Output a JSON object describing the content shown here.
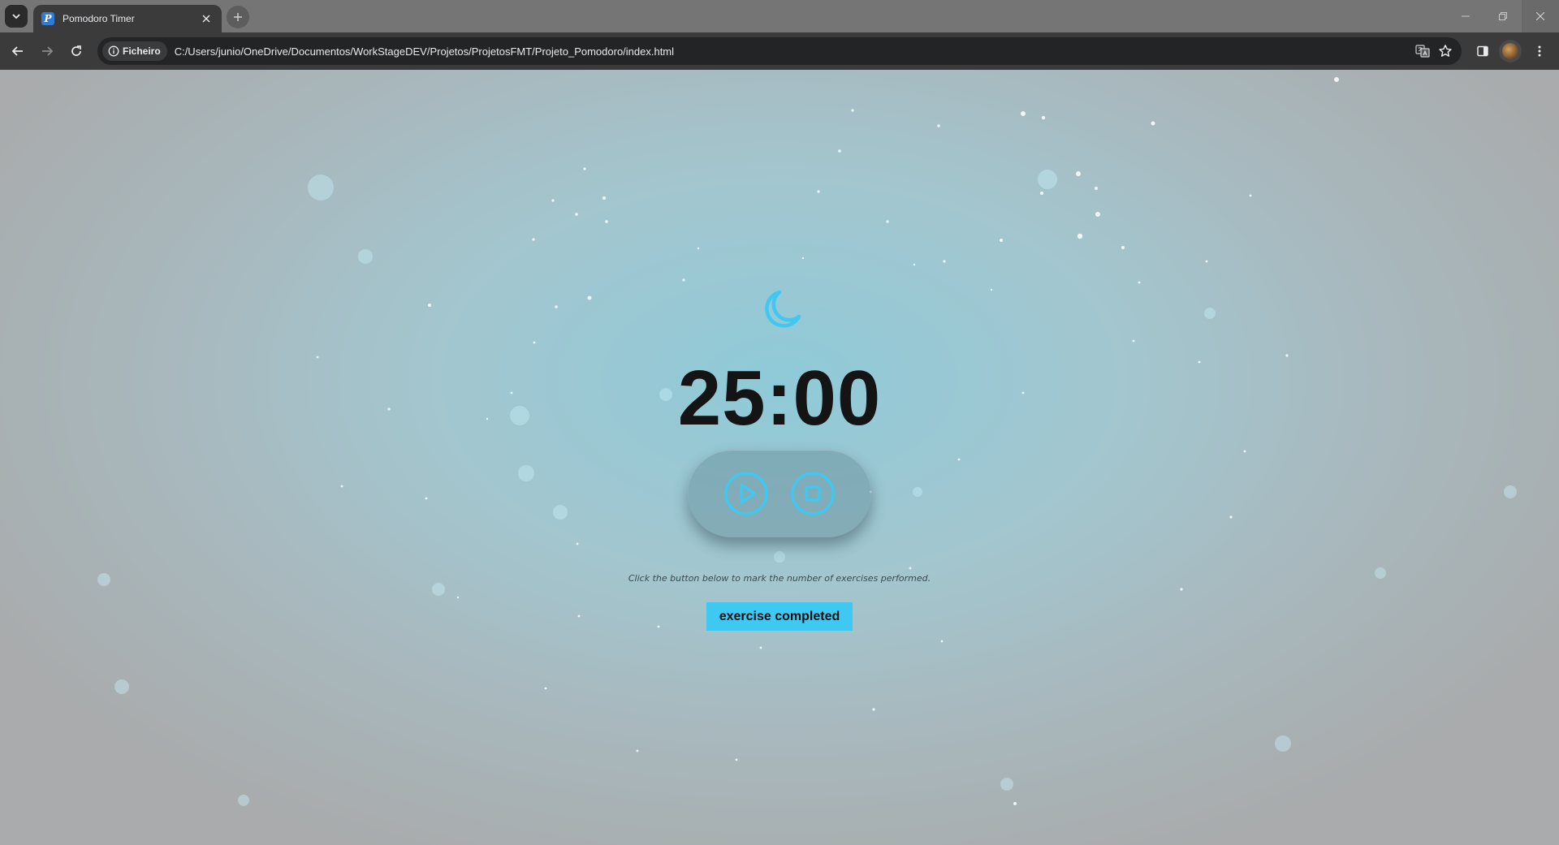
{
  "browser": {
    "tab_title": "Pomodoro Timer",
    "favicon_letter": "P",
    "security_chip": "Ficheiro",
    "url": "C:/Users/junio/OneDrive/Documentos/WorkStageDEV/Projetos/ProjetosFMT/Projeto_Pomodoro/index.html",
    "icons": [
      "tab-search-icon",
      "close-icon",
      "plus-icon",
      "minimize-icon",
      "restore-icon",
      "close-window-icon",
      "back-icon",
      "forward-icon",
      "reload-icon",
      "info-icon",
      "translate-icon",
      "star-icon",
      "side-panel-icon",
      "avatar",
      "more-icon"
    ]
  },
  "page": {
    "mode_icon": "moon-icon",
    "timer": "25:00",
    "controls": [
      "play-icon",
      "stop-icon"
    ],
    "hint": "Click the button below to mark the number of exercises performed.",
    "exercise_button": "exercise completed"
  },
  "colors": {
    "accent": "#3ec8f2",
    "timer_text": "#141414",
    "chrome_dark": "#3b3b3b",
    "omnibox": "#232426"
  }
}
